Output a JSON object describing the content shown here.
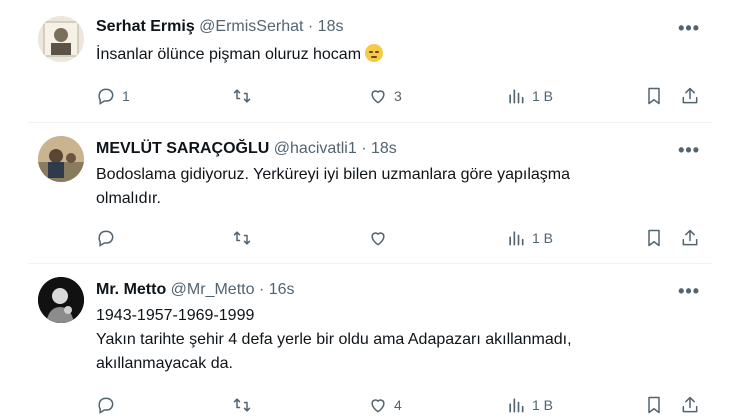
{
  "tweets": [
    {
      "name": "Serhat Ermiş",
      "handle": "@ErmisSerhat",
      "dot": "·",
      "time": "18s",
      "lines": [
        "İnsanlar ölünce pişman oluruz hocam"
      ],
      "emoji": "relieved-face",
      "replies": "1",
      "retweets": "",
      "likes": "3",
      "views": "1 B"
    },
    {
      "name": "MEVLÜT SARAÇOĞLU",
      "handle": "@hacivatli1",
      "dot": "·",
      "time": "18s",
      "lines": [
        "Bodoslama gidiyoruz. Yerküreyi iyi bilen uzmanlara  göre yapılaşma",
        "olmalıdır."
      ],
      "replies": "",
      "retweets": "",
      "likes": "",
      "views": "1 B"
    },
    {
      "name": "Mr. Metto",
      "handle": "@Mr_Metto",
      "dot": "·",
      "time": "16s",
      "lines": [
        "1943-1957-1969-1999",
        "Yakın tarihte şehir 4 defa yerle bir oldu ama Adapazarı akıllanmadı,",
        "akıllanmayacak da."
      ],
      "replies": "",
      "retweets": "",
      "likes": "4",
      "views": "1 B"
    }
  ],
  "more_label": "•••",
  "colors": {
    "text": "#0f1419",
    "muted": "#536471",
    "divider": "#eff3f4"
  }
}
